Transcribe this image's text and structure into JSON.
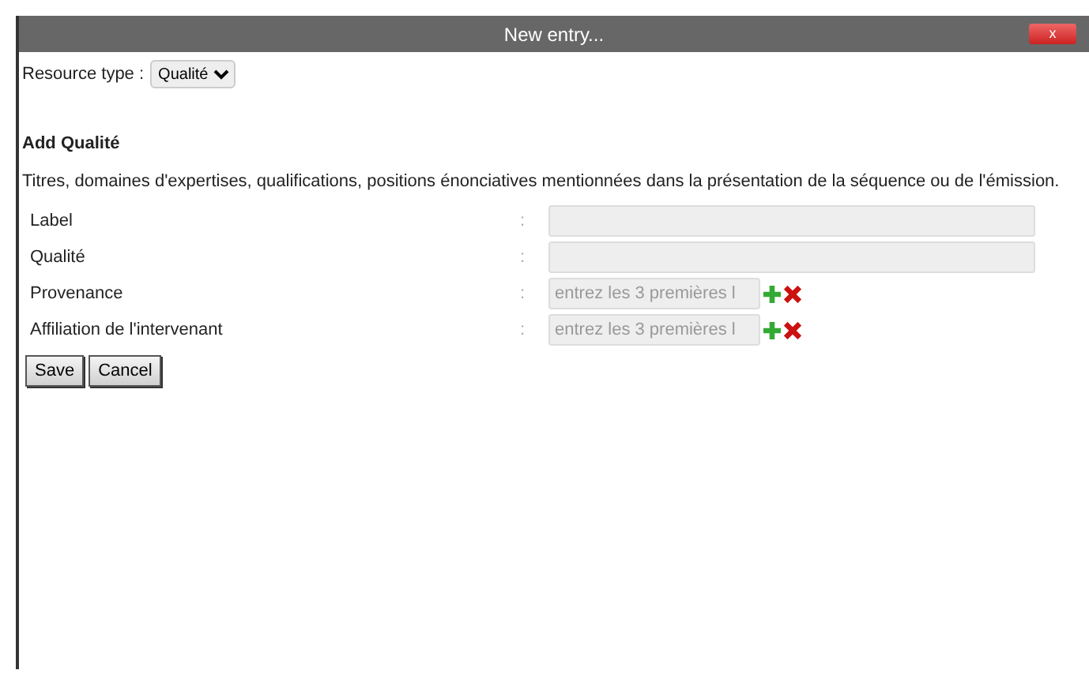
{
  "window": {
    "title": "New entry...",
    "close": "x"
  },
  "resource_type": {
    "label": "Resource type :",
    "value": "Qualité"
  },
  "heading": "Add Qualité",
  "description": "Titres, domaines d'expertises, qualifications, positions énonciatives mentionnées dans la présentation de la séquence ou de l'émission.",
  "fields": [
    {
      "label": "Label",
      "separator": ":",
      "kind": "text"
    },
    {
      "label": "Qualité",
      "separator": ":",
      "kind": "text"
    },
    {
      "label": "Provenance",
      "separator": ":",
      "kind": "lookup",
      "placeholder": "entrez les 3 premières l"
    },
    {
      "label": "Affiliation de l'intervenant",
      "separator": ":",
      "kind": "lookup",
      "placeholder": "entrez les 3 premières l"
    }
  ],
  "buttons": [
    "Save",
    "Cancel"
  ]
}
